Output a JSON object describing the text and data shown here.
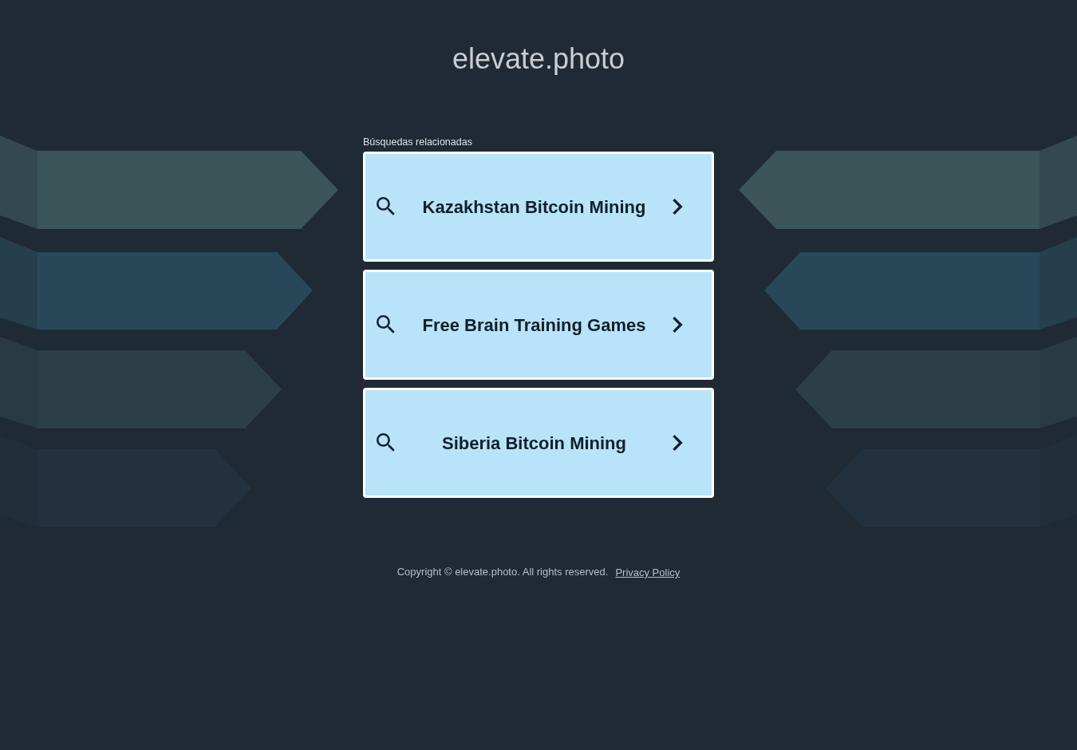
{
  "site": {
    "title": "elevate.photo"
  },
  "related_searches": {
    "heading": "Búsquedas relacionadas",
    "items": [
      {
        "label": "Kazakhstan Bitcoin Mining"
      },
      {
        "label": "Free Brain Training Games"
      },
      {
        "label": "Siberia Bitcoin Mining"
      }
    ]
  },
  "footer": {
    "copyright": "Copyright © elevate.photo. All rights reserved.",
    "privacy_link": "Privacy Policy"
  }
}
